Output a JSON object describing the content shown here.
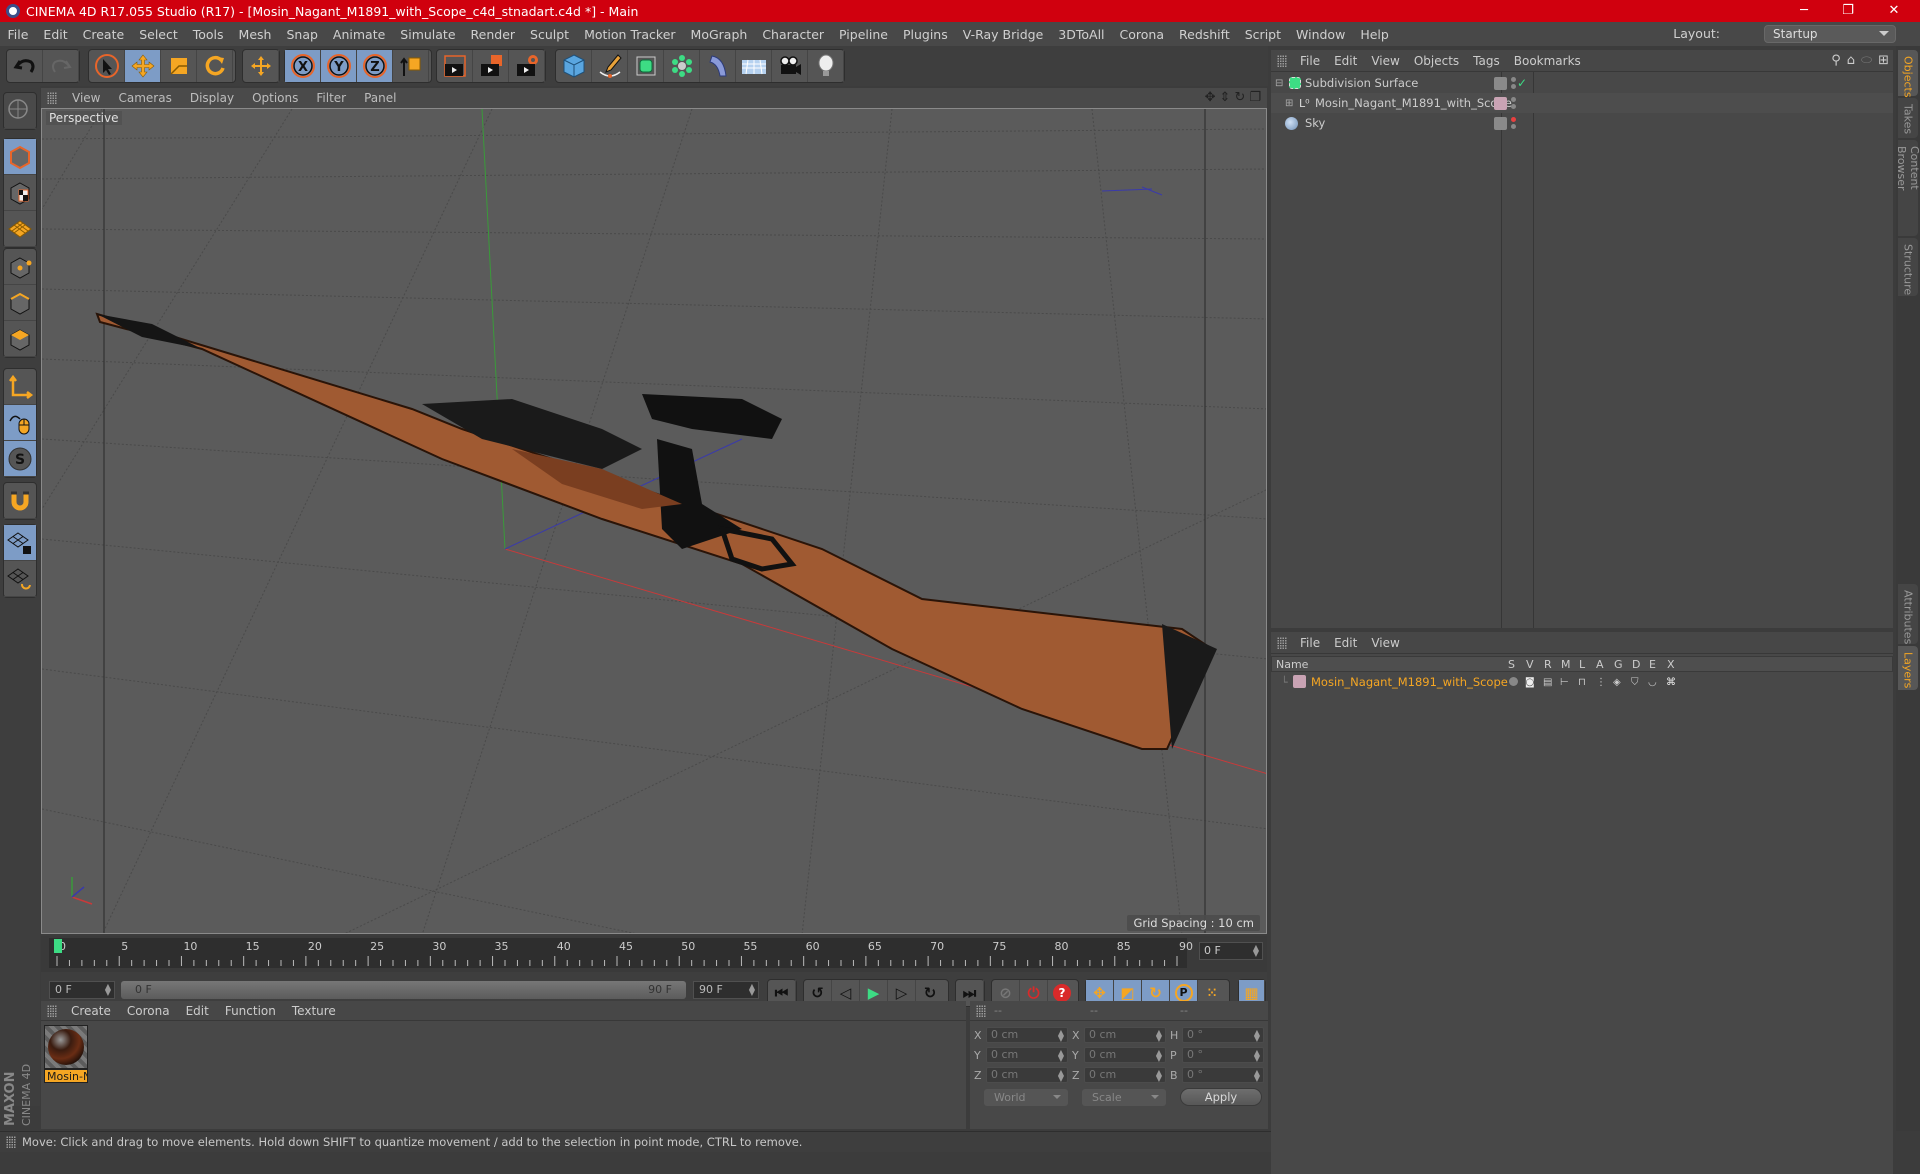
{
  "window": {
    "title": "CINEMA 4D R17.055 Studio (R17) - [Mosin_Nagant_M1891_with_Scope_c4d_stnadart.c4d *] - Main",
    "controls": {
      "minimize": "─",
      "maximize": "❐",
      "close": "✕"
    }
  },
  "menubar": {
    "items": [
      "File",
      "Edit",
      "Create",
      "Select",
      "Tools",
      "Mesh",
      "Snap",
      "Animate",
      "Simulate",
      "Render",
      "Sculpt",
      "Motion Tracker",
      "MoGraph",
      "Character",
      "Pipeline",
      "Plugins",
      "V-Ray Bridge",
      "3DToAll",
      "Corona",
      "Redshift",
      "Script",
      "Window",
      "Help"
    ],
    "layout_label": "Layout:",
    "layout_value": "Startup"
  },
  "toolbar": {
    "groups": [
      {
        "tools": [
          "undo",
          "redo"
        ]
      },
      {
        "tools": [
          "live-selection",
          "move",
          "scale",
          "rotate"
        ]
      },
      {
        "tools": [
          "last-tool"
        ]
      },
      {
        "tools": [
          "x-axis-lock",
          "y-axis-lock",
          "z-axis-lock",
          "coordinate-system"
        ]
      },
      {
        "tools": [
          "render-view",
          "render-to-picture-viewer",
          "render-settings"
        ]
      },
      {
        "tools": [
          "cube",
          "pen-spline",
          "subdivision-surface",
          "cloner",
          "bend-deformer",
          "floor",
          "camera",
          "light"
        ]
      }
    ]
  },
  "left_tools": [
    "make-editable",
    "model-mode",
    "texture-mode",
    "workplane-mode",
    "points-mode",
    "edges-mode",
    "polygons-mode",
    "axis-mode",
    "tweak-mode",
    "solo-mode",
    "snap",
    "workplane-lock",
    "workplane-align"
  ],
  "viewport": {
    "menu": [
      "View",
      "Cameras",
      "Display",
      "Options",
      "Filter",
      "Panel"
    ],
    "camera_label": "Perspective",
    "grid_spacing": "Grid Spacing : 10 cm",
    "nav_icons": [
      "move-view",
      "zoom-view",
      "rotate-view",
      "maximize-view"
    ]
  },
  "timeline": {
    "ticks": [
      "0",
      "5",
      "10",
      "15",
      "20",
      "25",
      "30",
      "35",
      "40",
      "45",
      "50",
      "55",
      "60",
      "65",
      "70",
      "75",
      "80",
      "85",
      "90"
    ],
    "current_frame": "0 F",
    "start_field": "0 F",
    "range_start": "0 F",
    "range_end": "90 F",
    "end_field": "90 F",
    "playhead_frame": 0,
    "max_frame": 90
  },
  "playback": {
    "buttons": [
      "go-to-start",
      "previous-key",
      "previous-frame",
      "play",
      "next-frame",
      "next-key",
      "go-to-end"
    ],
    "record_buttons": [
      "record-active",
      "autokey",
      "keyframe-selection"
    ],
    "key_buttons": [
      "key-position",
      "key-scale",
      "key-rotation",
      "key-parameter",
      "key-pla"
    ],
    "timeline_button": "timeline"
  },
  "material_manager": {
    "menu": [
      "Create",
      "Corona",
      "Edit",
      "Function",
      "Texture"
    ],
    "materials": [
      {
        "name": "Mosin-N"
      }
    ]
  },
  "coordinates": {
    "headers": [
      "--",
      "--",
      "--"
    ],
    "rows": [
      {
        "l1": "X",
        "v1": "0 cm",
        "l2": "X",
        "v2": "0 cm",
        "l3": "H",
        "v3": "0 °"
      },
      {
        "l1": "Y",
        "v1": "0 cm",
        "l2": "Y",
        "v2": "0 cm",
        "l3": "P",
        "v3": "0 °"
      },
      {
        "l1": "Z",
        "v1": "0 cm",
        "l2": "Z",
        "v2": "0 cm",
        "l3": "B",
        "v3": "0 °"
      }
    ],
    "space_select": "World",
    "mode_select": "Scale",
    "apply_label": "Apply"
  },
  "object_manager": {
    "menu": [
      "File",
      "Edit",
      "View",
      "Objects",
      "Tags",
      "Bookmarks"
    ],
    "objects": [
      {
        "name": "Subdivision Surface",
        "icon": "subdivision-surface",
        "tag_color": "#8a8a8a",
        "enabled": "✓"
      },
      {
        "name": "Mosin_Nagant_M1891_with_Scope",
        "icon": "null-object",
        "tag_color": "#c9a3b4"
      },
      {
        "name": "Sky",
        "icon": "sky",
        "tag_color": "#8a8a8a"
      }
    ]
  },
  "layer_manager": {
    "menu": [
      "File",
      "Edit",
      "View"
    ],
    "columns": [
      "Name",
      "S",
      "V",
      "R",
      "M",
      "L",
      "A",
      "G",
      "D",
      "E",
      "X"
    ],
    "layers": [
      {
        "name": "Mosin_Nagant_M1891_with_Scope",
        "color": "#c9a3b4"
      }
    ]
  },
  "side_tabs": {
    "top": [
      "Objects",
      "Takes",
      "Content Browser",
      "Structure"
    ],
    "bottom": [
      "Attributes",
      "Layers"
    ],
    "active_top": "Objects",
    "active_bottom": "Layers"
  },
  "status": {
    "message": "Move: Click and drag to move elements. Hold down SHIFT to quantize movement / add to the selection in point mode, CTRL to remove."
  },
  "colors": {
    "accent": "#f5a623",
    "title_bar": "#d0000e",
    "active_tool": "#7d9cc6",
    "viewport_bg": "#5b5b5b",
    "playhead": "#3ddc84"
  }
}
